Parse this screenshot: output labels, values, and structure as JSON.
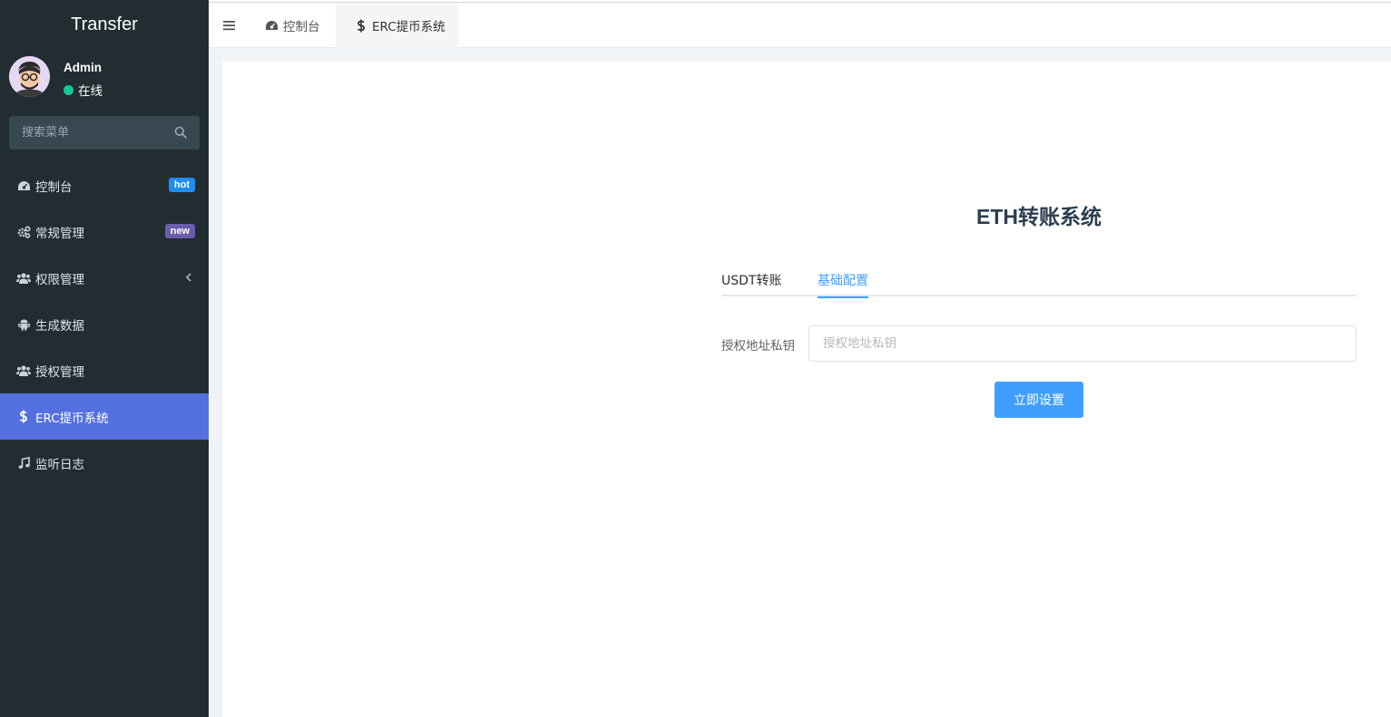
{
  "sidebar": {
    "brand": "Transfer",
    "user": {
      "name": "Admin",
      "status": "在线"
    },
    "search": {
      "placeholder": "搜索菜单",
      "icon": "search-icon"
    },
    "items": [
      {
        "label": "控制台",
        "icon": "dashboard-icon",
        "badge": "hot",
        "badge_color": "#1f8cf0"
      },
      {
        "label": "常规管理",
        "icon": "cogs-icon",
        "badge": "new",
        "badge_color": "#6b5cad"
      },
      {
        "label": "权限管理",
        "icon": "users-icon",
        "expandable": true
      },
      {
        "label": "生成数据",
        "icon": "android-icon"
      },
      {
        "label": "授权管理",
        "icon": "users-icon"
      },
      {
        "label": "ERC提币系统",
        "icon": "dollar-icon",
        "active": true
      },
      {
        "label": "监听日志",
        "icon": "music-icon"
      }
    ],
    "colors": {
      "background": "#222d32",
      "active": "#5470e0"
    }
  },
  "topbar": {
    "tabs": [
      {
        "label": "控制台",
        "icon": "dashboard-icon"
      },
      {
        "label": "ERC提币系统",
        "icon": "dollar-icon",
        "active": true
      }
    ]
  },
  "main": {
    "title": "ETH转账系统",
    "tabs": [
      {
        "label": "USDT转账"
      },
      {
        "label": "基础配置",
        "active": true
      }
    ],
    "field": {
      "label": "授权地址私钥",
      "placeholder": "授权地址私钥",
      "value": ""
    },
    "submit_label": "立即设置",
    "colors": {
      "primary": "#409eff"
    }
  }
}
